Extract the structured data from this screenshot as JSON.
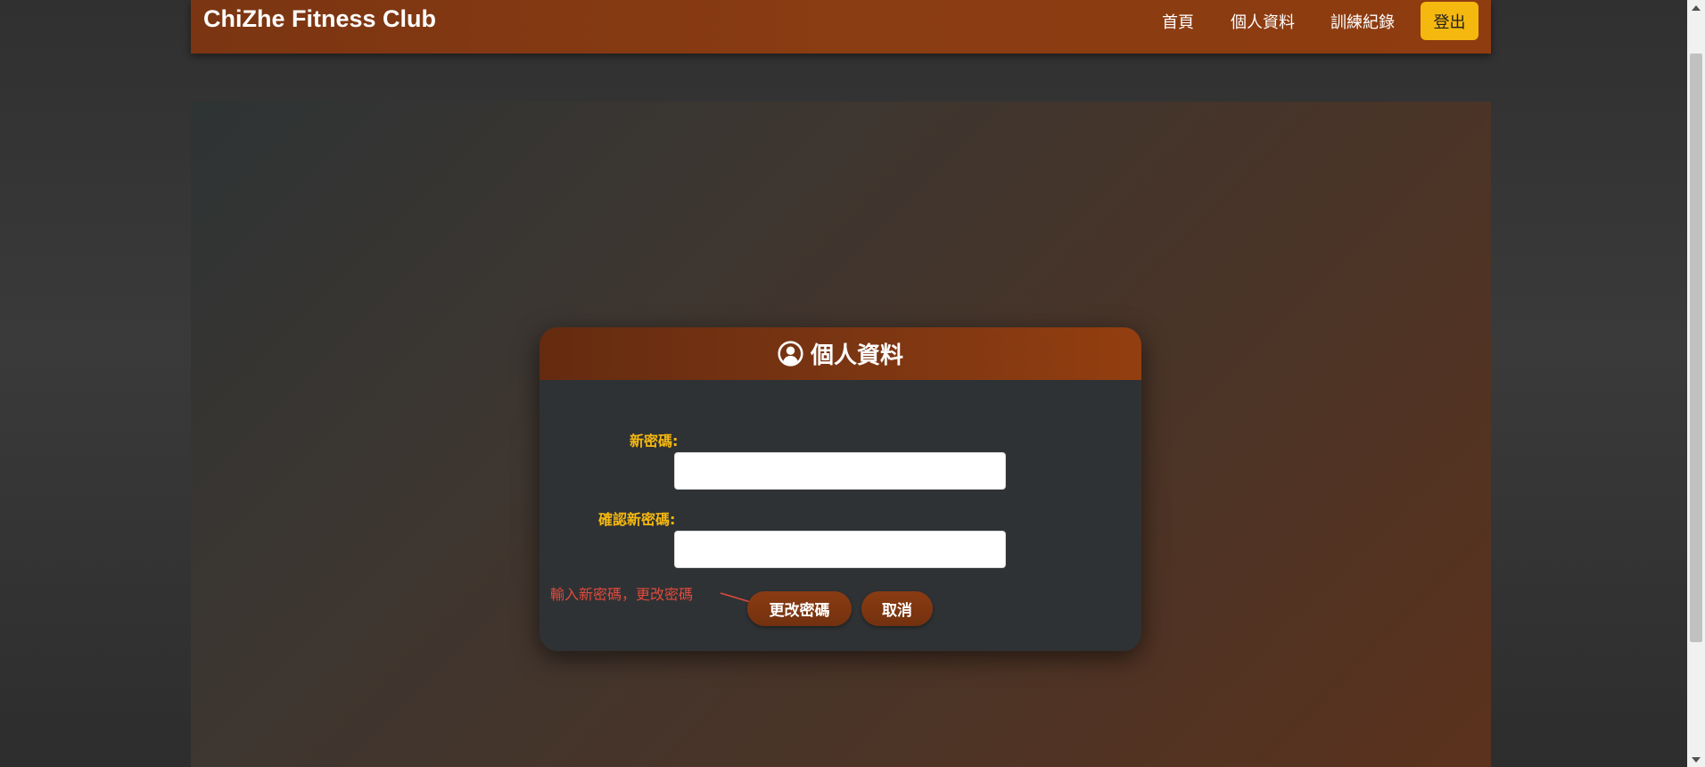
{
  "navbar": {
    "brand": "ChiZhe Fitness Club",
    "links": [
      {
        "label": "首頁"
      },
      {
        "label": "個人資料"
      },
      {
        "label": "訓練紀錄"
      }
    ],
    "logout_label": "登出",
    "logout_color": "#f5b80f"
  },
  "card": {
    "icon": "user-circle-icon",
    "title": "個人資料",
    "new_password_label": "新密碼:",
    "new_password_value": "",
    "confirm_password_label": "確認新密碼:",
    "confirm_password_value": "",
    "note": "輸入新密碼，更改密碼",
    "note_color": "#e04a3c",
    "change_button_label": "更改密碼",
    "cancel_button_label": "取消"
  },
  "colors": {
    "accent": "#8a3c12",
    "label": "#f5b80f"
  }
}
